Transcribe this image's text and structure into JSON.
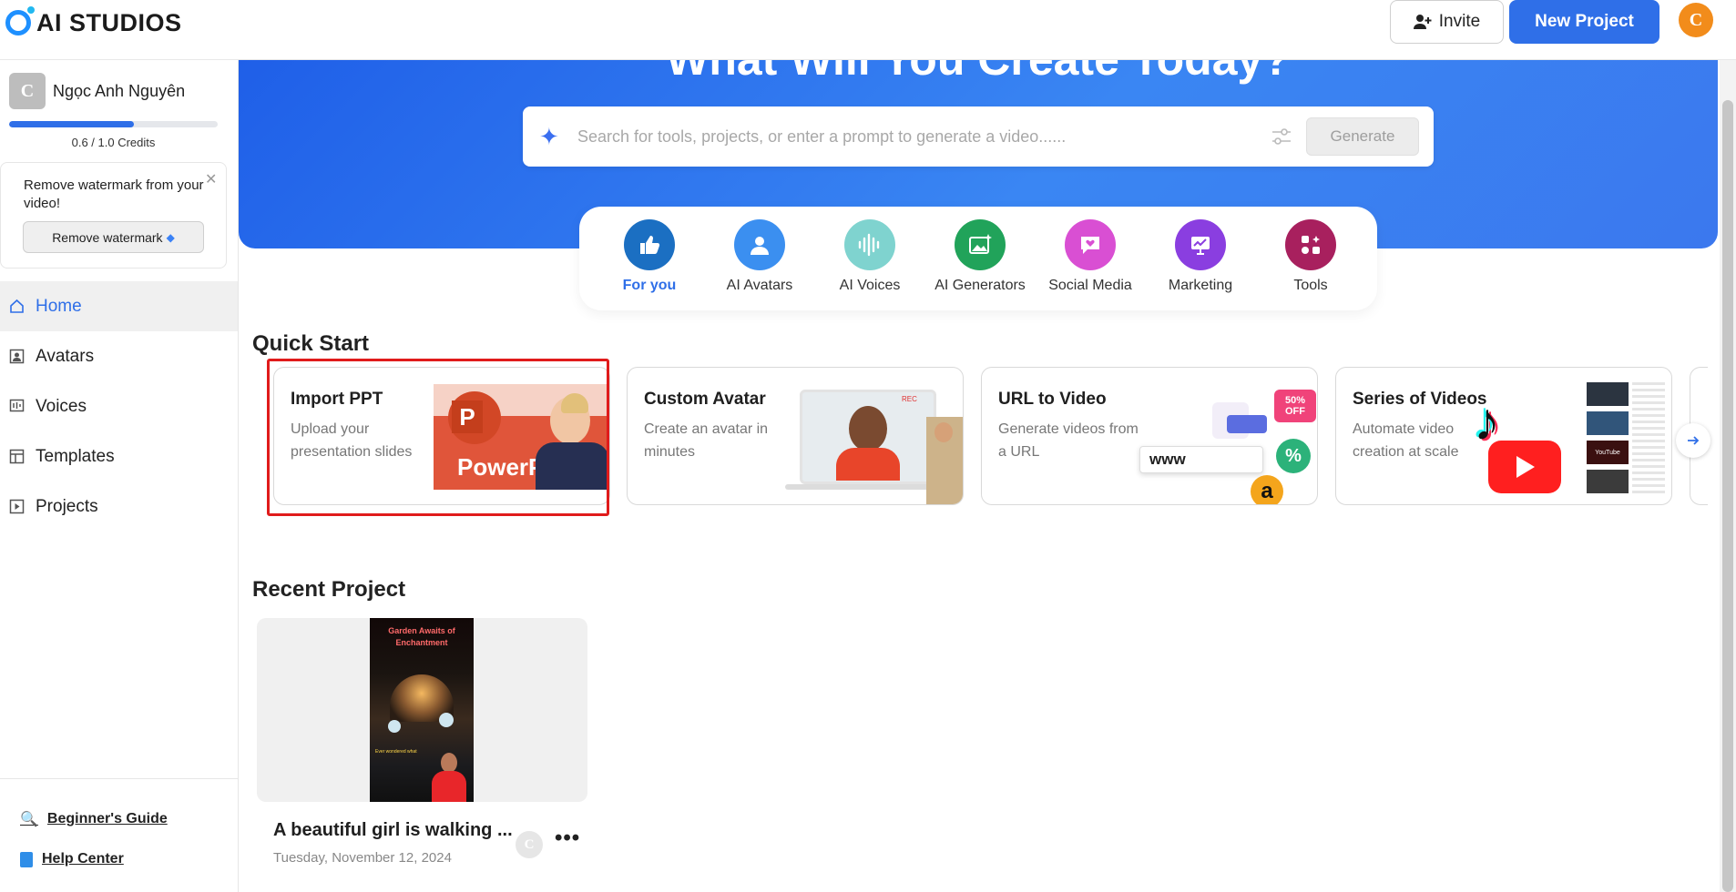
{
  "app": {
    "logo_text": "AI STUDIOS"
  },
  "topbar": {
    "invite_label": "Invite",
    "new_project_label": "New Project",
    "user_initial": "C"
  },
  "sidebar": {
    "user_initial": "C",
    "user_name": "Ngọc Anh Nguyên",
    "credits_text": "0.6 / 1.0 Credits",
    "credits_used": 0.6,
    "credits_total": 1.0,
    "watermark_text": "Remove watermark from your video!",
    "watermark_button": "Remove watermark",
    "nav": [
      {
        "label": "Home",
        "icon": "home-icon",
        "active": true
      },
      {
        "label": "Avatars",
        "icon": "avatar-icon",
        "active": false
      },
      {
        "label": "Voices",
        "icon": "voice-icon",
        "active": false
      },
      {
        "label": "Templates",
        "icon": "template-icon",
        "active": false
      },
      {
        "label": "Projects",
        "icon": "play-icon",
        "active": false
      }
    ],
    "footer_links": [
      {
        "label": "Beginner's Guide",
        "icon": "magnifier-icon"
      },
      {
        "label": "Help Center",
        "icon": "book-icon"
      }
    ]
  },
  "hero": {
    "title": "What Will You Create Today?",
    "search_placeholder": "Search for tools, projects, or enter a prompt to generate a video......",
    "generate_label": "Generate"
  },
  "categories": [
    {
      "label": "For you",
      "color": "#1b6fc2",
      "icon": "thumbs-up-icon",
      "active": true
    },
    {
      "label": "AI Avatars",
      "color": "#3b8ff0",
      "icon": "person-icon",
      "active": false
    },
    {
      "label": "AI Voices",
      "color": "#7fd3cf",
      "icon": "waveform-icon",
      "active": false
    },
    {
      "label": "AI Generators",
      "color": "#21a35a",
      "icon": "image-sparkle-icon",
      "active": false
    },
    {
      "label": "Social Media",
      "color": "#d94fd3",
      "icon": "heart-chat-icon",
      "active": false
    },
    {
      "label": "Marketing",
      "color": "#8a3ee0",
      "icon": "presentation-icon",
      "active": false
    },
    {
      "label": "Tools",
      "color": "#a8205e",
      "icon": "tools-grid-icon",
      "active": false
    }
  ],
  "quick_start": {
    "title": "Quick Start",
    "cards": [
      {
        "title": "Import PPT",
        "desc": "Upload your presentation slides",
        "art_text": "PowerP",
        "art_letter": "P"
      },
      {
        "title": "Custom Avatar",
        "desc": "Create an avatar in minutes",
        "art_text": "REC"
      },
      {
        "title": "URL to Video",
        "desc": "Generate videos from a URL",
        "art_text": "www",
        "badge": "50% OFF",
        "percent": "%"
      },
      {
        "title": "Series of Videos",
        "desc": "Automate video creation at scale",
        "art_text": "YouTube"
      }
    ]
  },
  "recent": {
    "title": "Recent Project",
    "project_name": "A beautiful girl is walking ...",
    "project_date": "Tuesday, November 12, 2024",
    "poster_title": "Garden Awaits of Enchantment",
    "poster_caption": "Ever wondered what",
    "owner_initial": "C"
  }
}
